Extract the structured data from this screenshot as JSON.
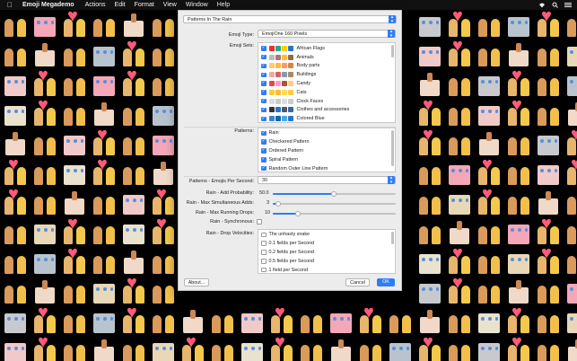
{
  "menubar": {
    "app_name": "Emoji Megademo",
    "menus": [
      "Actions",
      "Edit",
      "Format",
      "View",
      "Window",
      "Help"
    ]
  },
  "dialog": {
    "preset": "Patterns In The Rain",
    "emoji_type_label": "Emoji Type:",
    "emoji_type_value": "EmojiOne 160 Pixels",
    "emoji_sets_label": "Emoji Sets:",
    "emoji_sets": [
      {
        "label": "African Flags",
        "checked": true,
        "colors": [
          "#d33",
          "#2a8",
          "#fc0",
          "#27c"
        ]
      },
      {
        "label": "Animals",
        "checked": true,
        "colors": [
          "#bbb",
          "#a77",
          "#fb3",
          "#964"
        ]
      },
      {
        "label": "Body parts",
        "checked": true,
        "colors": [
          "#fc6",
          "#fb4",
          "#f96",
          "#c84"
        ]
      },
      {
        "label": "Buildings",
        "checked": true,
        "colors": [
          "#eaa",
          "#c66",
          "#89a",
          "#a86"
        ]
      },
      {
        "label": "Candy",
        "checked": true,
        "colors": [
          "#e44",
          "#f9c",
          "#a53",
          "#fc8"
        ]
      },
      {
        "label": "Cats",
        "checked": true,
        "colors": [
          "#fc3",
          "#fb3",
          "#fd5",
          "#fc4"
        ]
      },
      {
        "label": "Clock Faces",
        "checked": true,
        "colors": [
          "#ddd",
          "#ccc",
          "#ddd",
          "#ccc"
        ]
      },
      {
        "label": "Clothes and accessories",
        "checked": true,
        "colors": [
          "#333",
          "#27c",
          "#556",
          "#36a"
        ]
      },
      {
        "label": "Colored Blue",
        "checked": true,
        "colors": [
          "#38c",
          "#16a",
          "#4ae",
          "#27c"
        ]
      }
    ],
    "patterns_label": "Patterns:",
    "patterns": [
      {
        "label": "Rain",
        "checked": true
      },
      {
        "label": "Checkered Pattern",
        "checked": true
      },
      {
        "label": "Ordered Pattern",
        "checked": true
      },
      {
        "label": "Spiral Pattern",
        "checked": true
      },
      {
        "label": "Random Outer Line Pattern",
        "checked": true
      }
    ],
    "emojis_per_second_label": "Patterns - Emojis Per Second:",
    "emojis_per_second_value": "30",
    "add_probability_label": "Rain - Add Probability:",
    "add_probability_value": "50.0",
    "max_adds_label": "Rain - Max Simultaneous Adds:",
    "max_adds_value": "3",
    "max_drops_label": "Rain - Max Running Drops:",
    "max_drops_value": "10",
    "synchronous_label": "Rain - Synchronous:",
    "synchronous_checked": false,
    "drop_velocities_label": "Rain - Drop Velocities:",
    "drop_velocities": [
      {
        "label": "The unhasty snake",
        "checked": false
      },
      {
        "label": "0.1 fields per Second",
        "checked": false
      },
      {
        "label": "0.2 fields per Second",
        "checked": false
      },
      {
        "label": "0.5 fields per Second",
        "checked": false
      },
      {
        "label": "1 field per Second",
        "checked": false
      }
    ],
    "about_button": "About...",
    "cancel_button": "Cancel",
    "ok_button": "OK"
  },
  "colors": {
    "accent": "#2f7cf6",
    "dialog_bg": "#ececec"
  }
}
